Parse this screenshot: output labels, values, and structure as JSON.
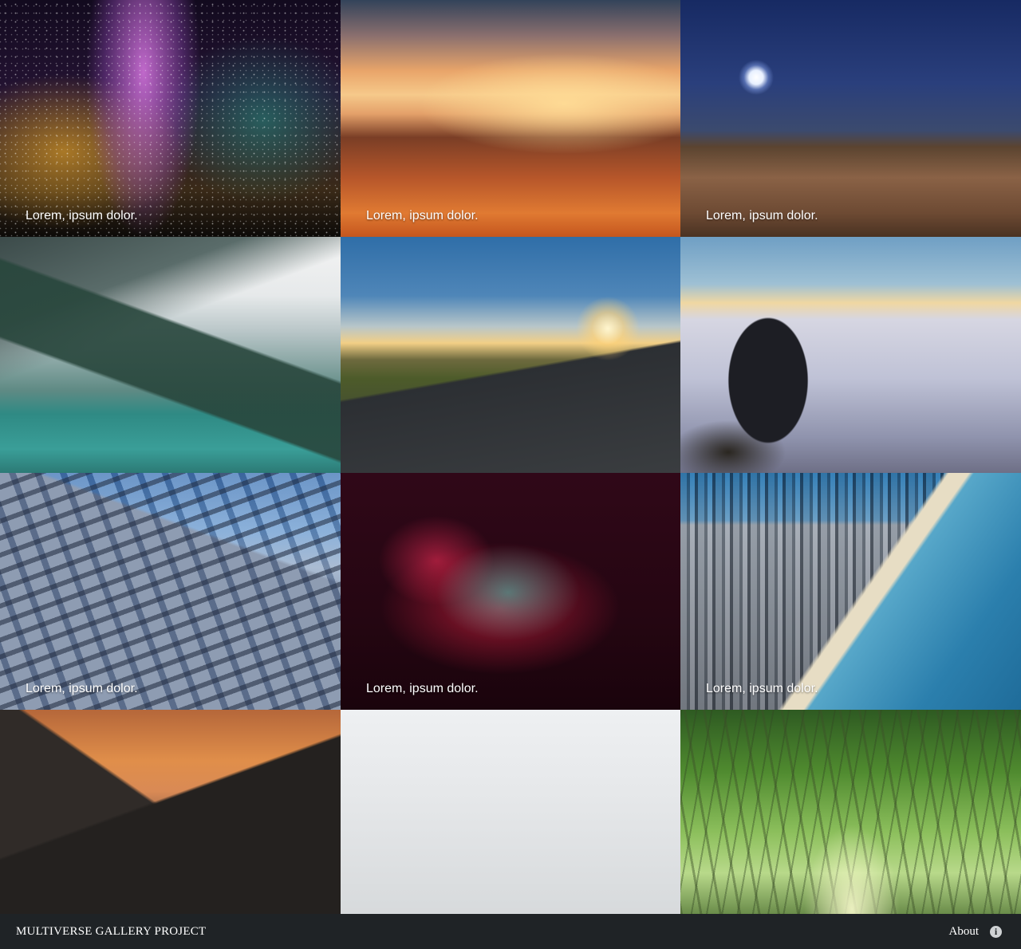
{
  "gallery": {
    "tiles": [
      {
        "caption": "Lorem, ipsum dolor.",
        "image": "milky-way-silhouette"
      },
      {
        "caption": "Lorem, ipsum dolor.",
        "image": "sunset-over-clouds"
      },
      {
        "caption": "Lorem, ipsum dolor.",
        "image": "night-desert-moon"
      },
      {
        "caption": "",
        "image": "mountain-lake"
      },
      {
        "caption": "",
        "image": "road-sunset"
      },
      {
        "caption": "",
        "image": "man-above-clouds"
      },
      {
        "caption": "Lorem, ipsum dolor.",
        "image": "office-building"
      },
      {
        "caption": "Lorem, ipsum dolor.",
        "image": "glowing-hands"
      },
      {
        "caption": "Lorem, ipsum dolor.",
        "image": "coastal-city"
      },
      {
        "caption": "",
        "image": "orange-mountains"
      },
      {
        "caption": "",
        "image": "person-in-beanie"
      },
      {
        "caption": "",
        "image": "bamboo-forest"
      }
    ]
  },
  "footer": {
    "brand": "MULTIVERSE GALLERY PROJECT",
    "about_label": "About",
    "info_icon": "info-icon",
    "background": "#1f2326"
  }
}
